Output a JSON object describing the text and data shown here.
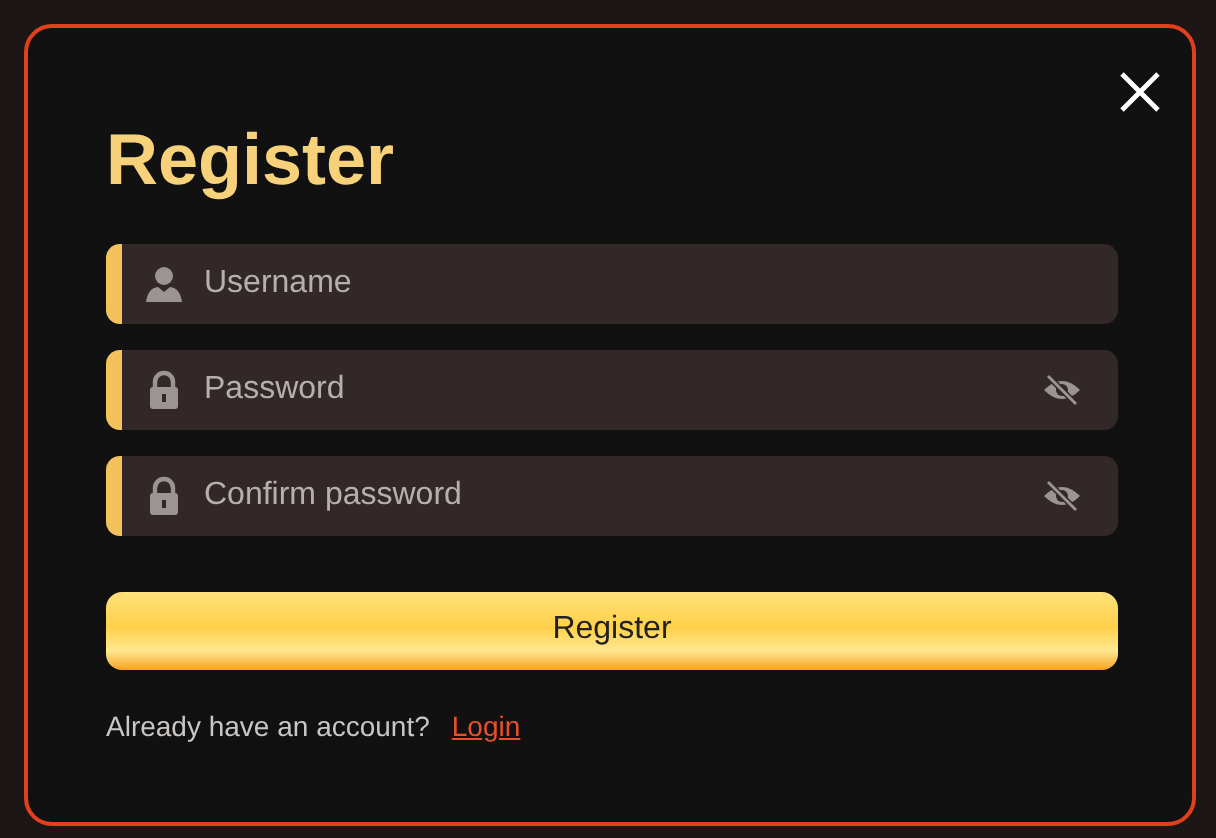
{
  "dialog": {
    "title": "Register",
    "fields": [
      {
        "kind": "username",
        "placeholder": "Username"
      },
      {
        "kind": "password",
        "placeholder": "Password"
      },
      {
        "kind": "password",
        "placeholder": "Confirm password"
      }
    ],
    "submit_button": "Register",
    "footer": {
      "prompt": "Already have an account?",
      "link": "Login"
    }
  }
}
